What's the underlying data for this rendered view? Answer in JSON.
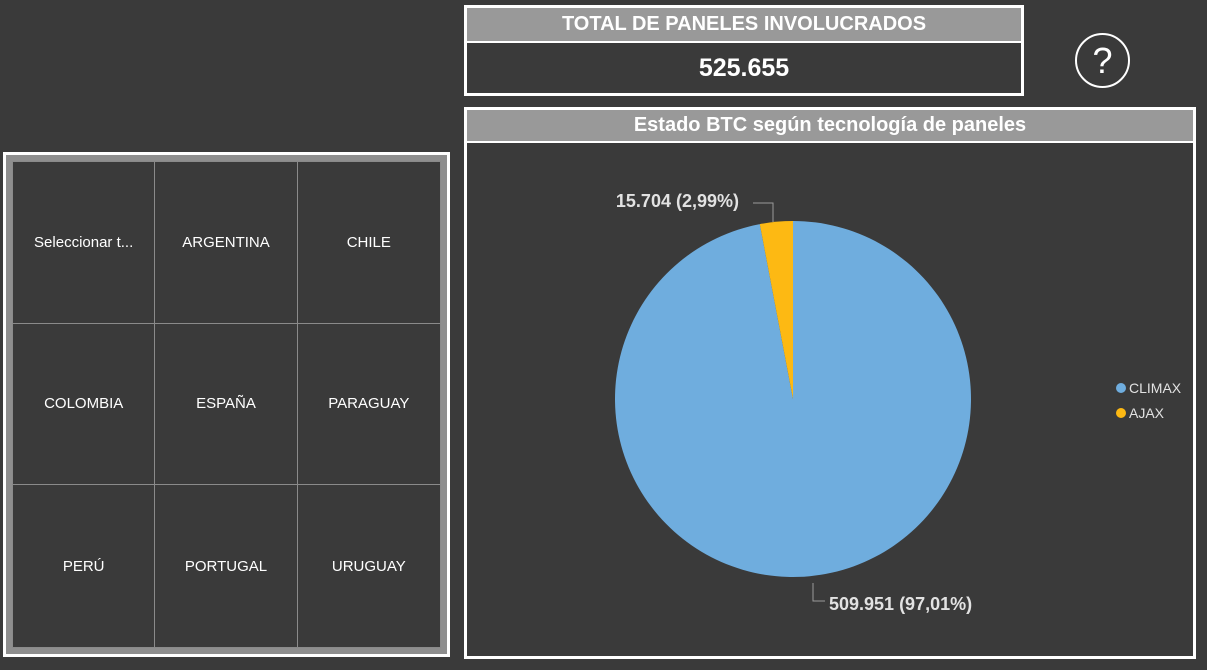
{
  "kpi": {
    "title": "TOTAL DE PANELES INVOLUCRADOS",
    "value": "525.655"
  },
  "help": {
    "symbol": "?"
  },
  "slicer": {
    "items": [
      "Seleccionar t...",
      "ARGENTINA",
      "CHILE",
      "COLOMBIA",
      "ESPAÑA",
      "PARAGUAY",
      "PERÚ",
      "PORTUGAL",
      "URUGUAY"
    ]
  },
  "chart": {
    "title": "Estado BTC según tecnología de paneles"
  },
  "chart_data": {
    "type": "pie",
    "title": "Estado BTC según tecnología de paneles",
    "slices": [
      {
        "name": "CLIMAX",
        "value": 509951,
        "label": "509.951 (97,01%)",
        "color": "#6fadde"
      },
      {
        "name": "AJAX",
        "value": 15704,
        "label": "15.704 (2,99%)",
        "color": "#fdb913"
      }
    ],
    "legend": [
      "CLIMAX",
      "AJAX"
    ],
    "legend_position": "right"
  }
}
